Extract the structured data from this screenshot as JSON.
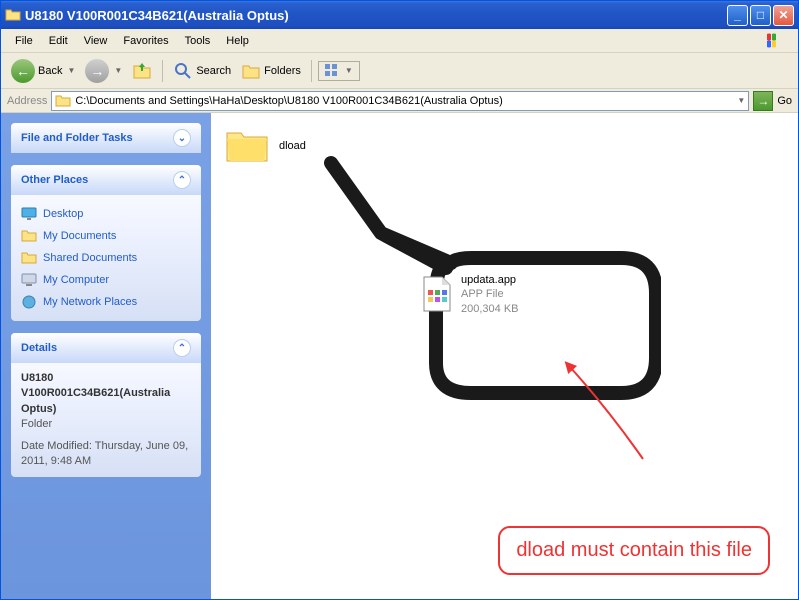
{
  "window": {
    "title": "U8180 V100R001C34B621(Australia Optus)"
  },
  "menu": {
    "file": "File",
    "edit": "Edit",
    "view": "View",
    "favorites": "Favorites",
    "tools": "Tools",
    "help": "Help"
  },
  "toolbar": {
    "back": "Back",
    "search": "Search",
    "folders": "Folders"
  },
  "address": {
    "label": "Address",
    "path": "C:\\Documents and Settings\\HaHa\\Desktop\\U8180 V100R001C34B621(Australia Optus)",
    "go": "Go"
  },
  "sidebar": {
    "tasks": {
      "title": "File and Folder Tasks"
    },
    "other": {
      "title": "Other Places",
      "items": [
        {
          "label": "Desktop"
        },
        {
          "label": "My Documents"
        },
        {
          "label": "Shared Documents"
        },
        {
          "label": "My Computer"
        },
        {
          "label": "My Network Places"
        }
      ]
    },
    "details": {
      "title": "Details",
      "name": "U8180 V100R001C34B621(Australia Optus)",
      "type": "Folder",
      "modified_label": "Date Modified: Thursday, June 09, 2011, 9:48 AM"
    }
  },
  "main": {
    "folder": {
      "name": "dload"
    },
    "file": {
      "name": "updata.app",
      "type": "APP File",
      "size": "200,304 KB"
    }
  },
  "annotation": {
    "text": "dload must contain this file"
  }
}
